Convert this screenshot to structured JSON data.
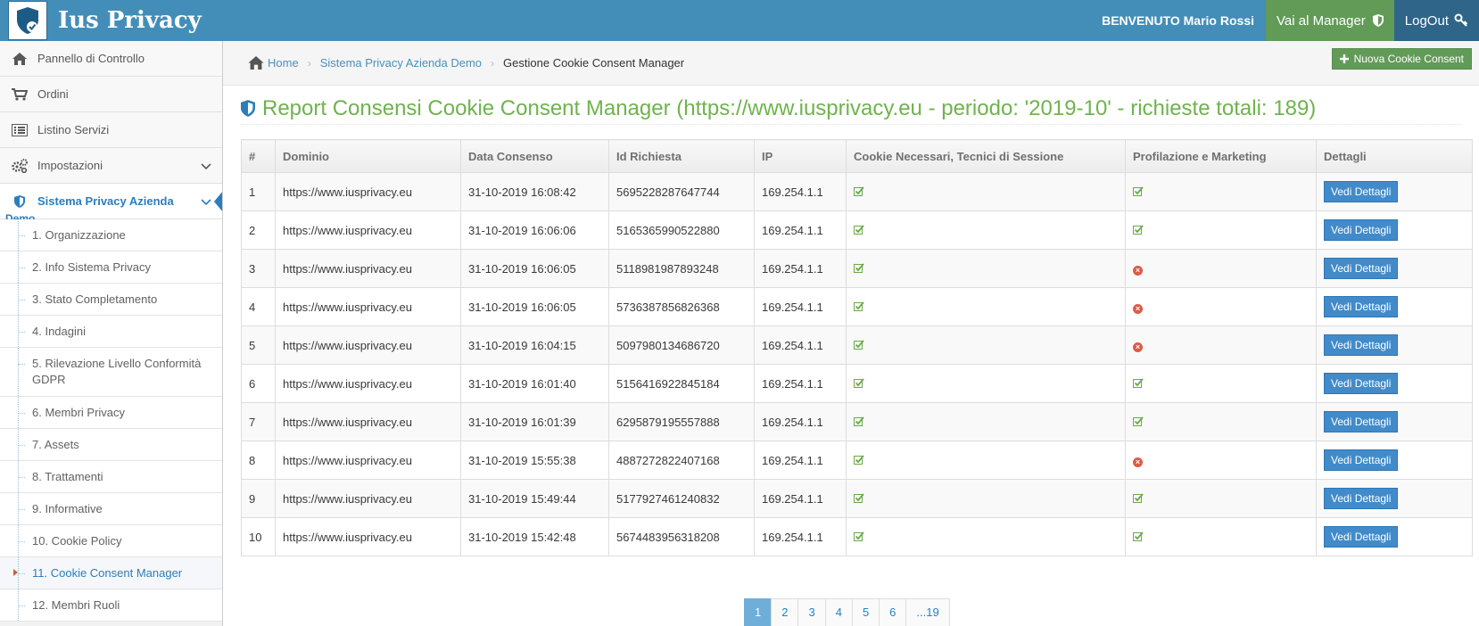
{
  "header": {
    "brand": "Ius Privacy",
    "welcome": "BENVENUTO Mario Rossi",
    "manager_label": "Vai al Manager",
    "logout_label": "LogOut"
  },
  "sidebar": {
    "items": [
      {
        "label": "Pannello di Controllo",
        "icon": "home-icon"
      },
      {
        "label": "Ordini",
        "icon": "cart-icon"
      },
      {
        "label": "Listino Servizi",
        "icon": "list-icon"
      },
      {
        "label": "Impostazioni",
        "icon": "gears-icon"
      }
    ],
    "active_label": "Sistema Privacy Azienda",
    "active_sub": "Demo",
    "sub_items": [
      "1. Organizzazione",
      "2. Info Sistema Privacy",
      "3. Stato Completamento",
      "4. Indagini",
      "5. Rilevazione Livello Conformità GDPR",
      "6. Membri Privacy",
      "7. Assets",
      "8. Trattamenti",
      "9. Informative",
      "10. Cookie Policy",
      "11. Cookie Consent Manager",
      "12. Membri Ruoli"
    ]
  },
  "breadcrumb": {
    "home": "Home",
    "level1": "Sistema Privacy Azienda Demo",
    "current": "Gestione Cookie Consent Manager"
  },
  "new_button": "Nuova Cookie Consent",
  "page_title": "Report Consensi Cookie Consent Manager (https://www.iusprivacy.eu - periodo: '2019-10' - richieste totali: 189)",
  "table": {
    "headers": [
      "#",
      "Dominio",
      "Data Consenso",
      "Id Richiesta",
      "IP",
      "Cookie Necessari, Tecnici di Sessione",
      "Profilazione e Marketing",
      "Dettagli"
    ],
    "button_label": "Vedi Dettagli",
    "rows": [
      {
        "n": "1",
        "domain": "https://www.iusprivacy.eu",
        "date": "31-10-2019 16:08:42",
        "id": "5695228287647744",
        "ip": "169.254.1.1",
        "necessary": true,
        "marketing": true
      },
      {
        "n": "2",
        "domain": "https://www.iusprivacy.eu",
        "date": "31-10-2019 16:06:06",
        "id": "5165365990522880",
        "ip": "169.254.1.1",
        "necessary": true,
        "marketing": true
      },
      {
        "n": "3",
        "domain": "https://www.iusprivacy.eu",
        "date": "31-10-2019 16:06:05",
        "id": "5118981987893248",
        "ip": "169.254.1.1",
        "necessary": true,
        "marketing": false
      },
      {
        "n": "4",
        "domain": "https://www.iusprivacy.eu",
        "date": "31-10-2019 16:06:05",
        "id": "5736387856826368",
        "ip": "169.254.1.1",
        "necessary": true,
        "marketing": false
      },
      {
        "n": "5",
        "domain": "https://www.iusprivacy.eu",
        "date": "31-10-2019 16:04:15",
        "id": "5097980134686720",
        "ip": "169.254.1.1",
        "necessary": true,
        "marketing": false
      },
      {
        "n": "6",
        "domain": "https://www.iusprivacy.eu",
        "date": "31-10-2019 16:01:40",
        "id": "5156416922845184",
        "ip": "169.254.1.1",
        "necessary": true,
        "marketing": true
      },
      {
        "n": "7",
        "domain": "https://www.iusprivacy.eu",
        "date": "31-10-2019 16:01:39",
        "id": "6295879195557888",
        "ip": "169.254.1.1",
        "necessary": true,
        "marketing": true
      },
      {
        "n": "8",
        "domain": "https://www.iusprivacy.eu",
        "date": "31-10-2019 15:55:38",
        "id": "4887272822407168",
        "ip": "169.254.1.1",
        "necessary": true,
        "marketing": false
      },
      {
        "n": "9",
        "domain": "https://www.iusprivacy.eu",
        "date": "31-10-2019 15:49:44",
        "id": "5177927461240832",
        "ip": "169.254.1.1",
        "necessary": true,
        "marketing": true
      },
      {
        "n": "10",
        "domain": "https://www.iusprivacy.eu",
        "date": "31-10-2019 15:42:48",
        "id": "5674483956318208",
        "ip": "169.254.1.1",
        "necessary": true,
        "marketing": true
      }
    ]
  },
  "pagination": {
    "pages": [
      "1",
      "2",
      "3",
      "4",
      "5",
      "6",
      "...19"
    ],
    "current": "1"
  }
}
